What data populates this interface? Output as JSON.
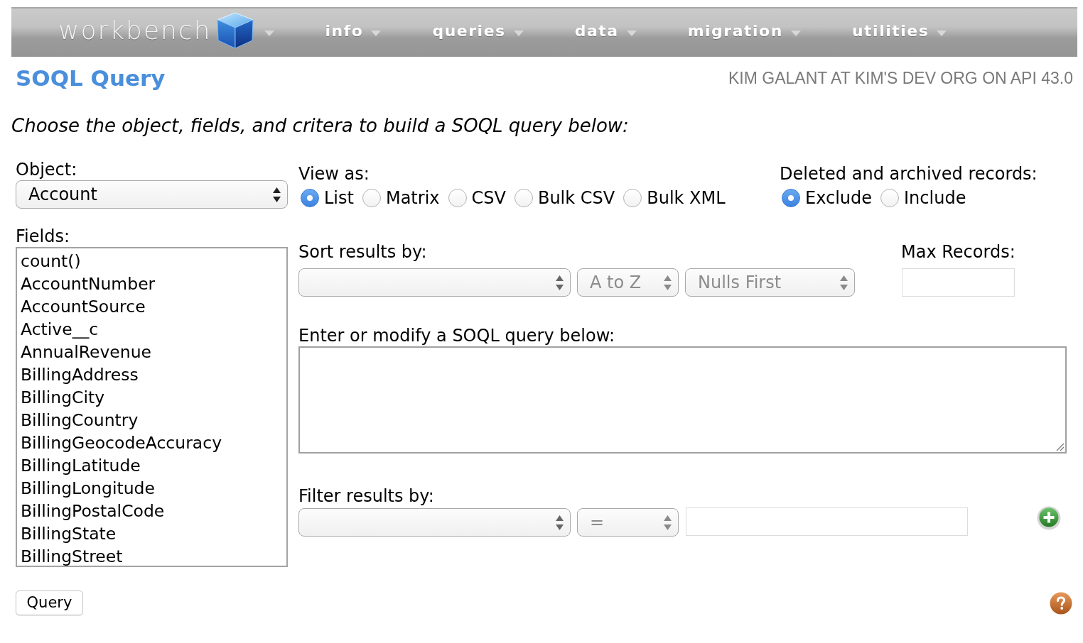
{
  "nav": {
    "logo": "workbench",
    "menus": [
      {
        "label": "info"
      },
      {
        "label": "queries"
      },
      {
        "label": "data"
      },
      {
        "label": "migration"
      },
      {
        "label": "utilities"
      }
    ]
  },
  "header": {
    "title": "SOQL Query",
    "user_info": "KIM GALANT AT KIM'S DEV ORG ON API 43.0"
  },
  "instructions": "Choose the object, fields, and critera to build a SOQL query below:",
  "object": {
    "label": "Object:",
    "value": "Account"
  },
  "fields": {
    "label": "Fields:",
    "items": [
      {
        "name": "count()",
        "selected": false
      },
      {
        "name": "AccountNumber",
        "selected": false
      },
      {
        "name": "AccountSource",
        "selected": false
      },
      {
        "name": "Active__c",
        "selected": false
      },
      {
        "name": "AnnualRevenue",
        "selected": false
      },
      {
        "name": "BillingAddress",
        "selected": false
      },
      {
        "name": "BillingCity",
        "selected": false
      },
      {
        "name": "BillingCountry",
        "selected": false
      },
      {
        "name": "BillingGeocodeAccuracy",
        "selected": false
      },
      {
        "name": "BillingLatitude",
        "selected": false
      },
      {
        "name": "BillingLongitude",
        "selected": false
      },
      {
        "name": "BillingPostalCode",
        "selected": false
      },
      {
        "name": "BillingState",
        "selected": false
      },
      {
        "name": "BillingStreet",
        "selected": false
      }
    ]
  },
  "view_as": {
    "label": "View as:",
    "options": [
      {
        "label": "List",
        "selected": true
      },
      {
        "label": "Matrix",
        "selected": false
      },
      {
        "label": "CSV",
        "selected": false
      },
      {
        "label": "Bulk CSV",
        "selected": false
      },
      {
        "label": "Bulk XML",
        "selected": false
      }
    ]
  },
  "deleted_records": {
    "label": "Deleted and archived records:",
    "options": [
      {
        "label": "Exclude",
        "selected": true
      },
      {
        "label": "Include",
        "selected": false
      }
    ]
  },
  "sort": {
    "label": "Sort results by:",
    "selects": [
      {
        "kind": "field",
        "disabled": false
      },
      {
        "kind": "order",
        "value": "A to Z",
        "disabled": true
      },
      {
        "kind": "nulls",
        "value": "Nulls First",
        "disabled": true
      }
    ]
  },
  "max_records": {
    "label": "Max Records:"
  },
  "query": {
    "label": "Enter or modify a SOQL query below:"
  },
  "filter": {
    "label": "Filter results by:",
    "selects": [
      {
        "kind": "field",
        "disabled": false
      },
      {
        "kind": "operator",
        "value": "=",
        "disabled": true
      }
    ]
  },
  "query_button": {
    "label": "Query"
  }
}
